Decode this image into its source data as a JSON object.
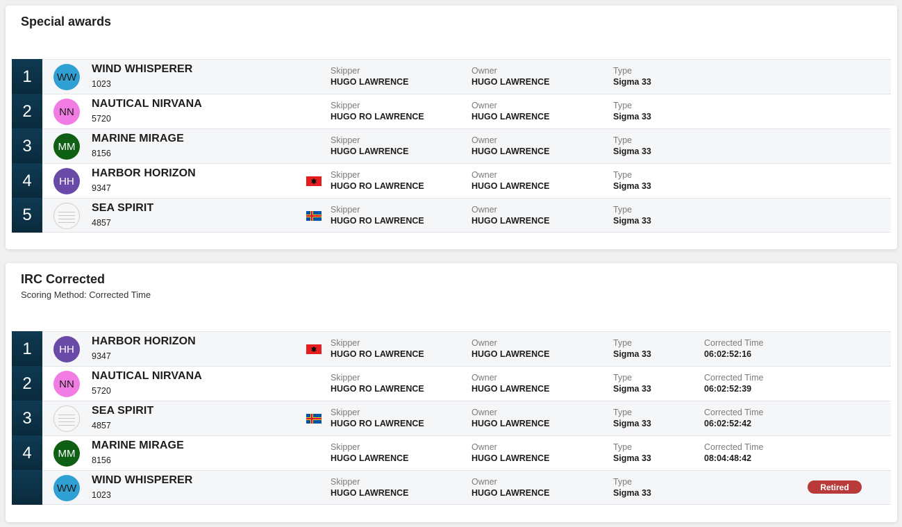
{
  "sections": [
    {
      "title": "Special awards",
      "subtitle": "",
      "rows": [
        {
          "position": "1",
          "initials": "WW",
          "avatar_color": "#2fa0d4",
          "avatar_text_color": "#1a1a1a",
          "name": "WIND WHISPERER",
          "sail": "1023",
          "flag": "",
          "skipper_label": "Skipper",
          "skipper": "HUGO LAWRENCE",
          "owner_label": "Owner",
          "owner": "HUGO LAWRENCE",
          "type_label": "Type",
          "type": "Sigma 33",
          "corrected_label": "",
          "corrected": "",
          "status": ""
        },
        {
          "position": "2",
          "initials": "NN",
          "avatar_color": "#f07ce4",
          "avatar_text_color": "#1a1a1a",
          "name": "NAUTICAL NIRVANA",
          "sail": "5720",
          "flag": "",
          "skipper_label": "Skipper",
          "skipper": "HUGO RO LAWRENCE",
          "owner_label": "Owner",
          "owner": "HUGO LAWRENCE",
          "type_label": "Type",
          "type": "Sigma 33",
          "corrected_label": "",
          "corrected": "",
          "status": ""
        },
        {
          "position": "3",
          "initials": "MM",
          "avatar_color": "#0f5f14",
          "avatar_text_color": "#ffffff",
          "name": "MARINE MIRAGE",
          "sail": "8156",
          "flag": "",
          "skipper_label": "Skipper",
          "skipper": "HUGO LAWRENCE",
          "owner_label": "Owner",
          "owner": "HUGO LAWRENCE",
          "type_label": "Type",
          "type": "Sigma 33",
          "corrected_label": "",
          "corrected": "",
          "status": ""
        },
        {
          "position": "4",
          "initials": "HH",
          "avatar_color": "#6a4aa8",
          "avatar_text_color": "#ffffff",
          "name": "HARBOR HORIZON",
          "sail": "9347",
          "flag": "albania-flag",
          "skipper_label": "Skipper",
          "skipper": "HUGO RO LAWRENCE",
          "owner_label": "Owner",
          "owner": "HUGO LAWRENCE",
          "type_label": "Type",
          "type": "Sigma 33",
          "corrected_label": "",
          "corrected": "",
          "status": ""
        },
        {
          "position": "5",
          "initials": "",
          "avatar_color": "logo",
          "avatar_text_color": "#1a1a1a",
          "name": "SEA SPIRIT",
          "sail": "4857",
          "flag": "aland-flag",
          "skipper_label": "Skipper",
          "skipper": "HUGO RO LAWRENCE",
          "owner_label": "Owner",
          "owner": "HUGO LAWRENCE",
          "type_label": "Type",
          "type": "Sigma 33",
          "corrected_label": "",
          "corrected": "",
          "status": ""
        }
      ]
    },
    {
      "title": "IRC Corrected",
      "subtitle": "Scoring Method: Corrected Time",
      "rows": [
        {
          "position": "1",
          "initials": "HH",
          "avatar_color": "#6a4aa8",
          "avatar_text_color": "#ffffff",
          "name": "HARBOR HORIZON",
          "sail": "9347",
          "flag": "albania-flag",
          "skipper_label": "Skipper",
          "skipper": "HUGO RO LAWRENCE",
          "owner_label": "Owner",
          "owner": "HUGO LAWRENCE",
          "type_label": "Type",
          "type": "Sigma 33",
          "corrected_label": "Corrected Time",
          "corrected": "06:02:52:16",
          "status": ""
        },
        {
          "position": "2",
          "initials": "NN",
          "avatar_color": "#f07ce4",
          "avatar_text_color": "#1a1a1a",
          "name": "NAUTICAL NIRVANA",
          "sail": "5720",
          "flag": "",
          "skipper_label": "Skipper",
          "skipper": "HUGO RO LAWRENCE",
          "owner_label": "Owner",
          "owner": "HUGO LAWRENCE",
          "type_label": "Type",
          "type": "Sigma 33",
          "corrected_label": "Corrected Time",
          "corrected": "06:02:52:39",
          "status": ""
        },
        {
          "position": "3",
          "initials": "",
          "avatar_color": "logo",
          "avatar_text_color": "#1a1a1a",
          "name": "SEA SPIRIT",
          "sail": "4857",
          "flag": "aland-flag",
          "skipper_label": "Skipper",
          "skipper": "HUGO RO LAWRENCE",
          "owner_label": "Owner",
          "owner": "HUGO LAWRENCE",
          "type_label": "Type",
          "type": "Sigma 33",
          "corrected_label": "Corrected Time",
          "corrected": "06:02:52:42",
          "status": ""
        },
        {
          "position": "4",
          "initials": "MM",
          "avatar_color": "#0f5f14",
          "avatar_text_color": "#ffffff",
          "name": "MARINE MIRAGE",
          "sail": "8156",
          "flag": "",
          "skipper_label": "Skipper",
          "skipper": "HUGO LAWRENCE",
          "owner_label": "Owner",
          "owner": "HUGO LAWRENCE",
          "type_label": "Type",
          "type": "Sigma 33",
          "corrected_label": "Corrected Time",
          "corrected": "08:04:48:42",
          "status": ""
        },
        {
          "position": "",
          "initials": "WW",
          "avatar_color": "#2fa0d4",
          "avatar_text_color": "#1a1a1a",
          "name": "WIND WHISPERER",
          "sail": "1023",
          "flag": "",
          "skipper_label": "Skipper",
          "skipper": "HUGO LAWRENCE",
          "owner_label": "Owner",
          "owner": "HUGO LAWRENCE",
          "type_label": "Type",
          "type": "Sigma 33",
          "corrected_label": "",
          "corrected": "",
          "status": "Retired"
        }
      ]
    }
  ],
  "colors": {
    "position_bg": "#0c3248",
    "retired_badge": "#b83a3a",
    "albania_red": "#e41e20",
    "aland_blue": "#0053a5",
    "aland_yellow": "#ffce00",
    "aland_red": "#d21034"
  }
}
